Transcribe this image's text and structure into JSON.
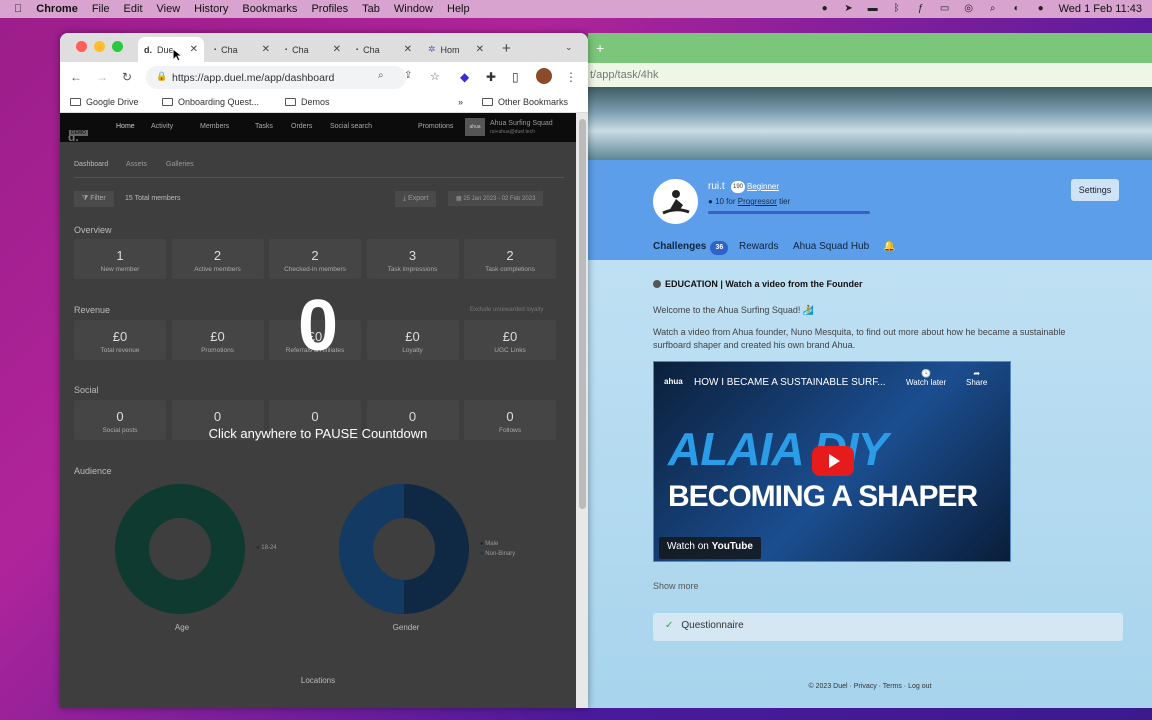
{
  "menubar": {
    "app": "Chrome",
    "items": [
      "File",
      "Edit",
      "View",
      "History",
      "Bookmarks",
      "Profiles",
      "Tab",
      "Window",
      "Help"
    ],
    "clock": "Wed 1 Feb  11:43"
  },
  "left_browser": {
    "tabs": [
      {
        "icon_text": "d.",
        "label": "Due"
      },
      {
        "label": "Cha"
      },
      {
        "label": "Cha"
      },
      {
        "label": "Cha"
      },
      {
        "label": "Hom"
      }
    ],
    "url": "https://app.duel.me/app/dashboard",
    "bookmarks": [
      "Google Drive",
      "Onboarding Quest...",
      "Demos"
    ],
    "other_bookmarks": "Other Bookmarks",
    "chevron": "»"
  },
  "dashboard": {
    "logo": "d.",
    "logo_tag": "DEMO",
    "nav": [
      "Home",
      "Activity",
      "Members",
      "Tasks",
      "Orders",
      "Social search",
      "Promotions"
    ],
    "account_name": "Ahua Surfing Squad",
    "account_email": "rui+ahua@duel.tech",
    "account_logo": "ahua",
    "subtabs": [
      "Dashboard",
      "Assets",
      "Galleries"
    ],
    "filter": "Filter",
    "members_total": "15 Total members",
    "export": "Export",
    "date_range": "25 Jan 2023 - 02 Feb 2023",
    "overview_title": "Overview",
    "overview": [
      {
        "value": "1",
        "label": "New member"
      },
      {
        "value": "2",
        "label": "Active members"
      },
      {
        "value": "2",
        "label": "Checked-in members"
      },
      {
        "value": "3",
        "label": "Task impressions"
      },
      {
        "value": "2",
        "label": "Task completions"
      }
    ],
    "revenue_title": "Revenue",
    "exclude_label": "Exclude unrewarded loyalty",
    "revenue": [
      {
        "value": "£0",
        "label": "Total revenue"
      },
      {
        "value": "£0",
        "label": "Promotions"
      },
      {
        "value": "£0",
        "label": "Referrals & Affiliates"
      },
      {
        "value": "£0",
        "label": "Loyalty"
      },
      {
        "value": "£0",
        "label": "UGC Links"
      }
    ],
    "social_title": "Social",
    "social": [
      {
        "value": "0",
        "label": "Social posts"
      },
      {
        "value": "0",
        "label": ""
      },
      {
        "value": "0",
        "label": ""
      },
      {
        "value": "0",
        "label": ""
      },
      {
        "value": "0",
        "label": "Follows"
      }
    ],
    "audience_title": "Audience",
    "age_legend": "18-24",
    "gender_legend": [
      "Male",
      "Non-Binary"
    ],
    "age_caption": "Age",
    "gender_caption": "Gender",
    "locations": "Locations"
  },
  "countdown": {
    "number": "0",
    "message": "Click anywhere to PAUSE Countdown"
  },
  "right_page": {
    "url_fragment": "t/app/task/4hk",
    "username": "rui.t",
    "level": "190",
    "rank": "Beginner",
    "tier_prefix": "10 for",
    "tier_link": "Progressor",
    "tier_suffix": "tier",
    "settings": "Settings",
    "tabs": {
      "challenges": "Challenges",
      "challenges_count": "36",
      "rewards": "Rewards",
      "hub": "Ahua Squad Hub"
    },
    "task_title": "EDUCATION | Watch a video from the Founder",
    "welcome": "Welcome to the Ahua Surfing Squad! 🏄",
    "description": "Watch a video from Ahua founder, Nuno Mesquita, to find out more about how he became a sustainable surfboard shaper and created his own brand Ahua.",
    "video": {
      "channel": "ahua",
      "title": "HOW I BECAME A SUSTAINABLE SURF...",
      "big1": "ALAIA DIY",
      "big2": "BECOMING A SHAPER",
      "watch_later": "Watch later",
      "share": "Share",
      "watch_on": "Watch on",
      "yt": "YouTube"
    },
    "show_more": "Show more",
    "questionnaire": "Questionnaire",
    "footer": "© 2023 Duel  ·  Privacy  ·  Terms  ·  Log out"
  },
  "colors": {
    "accent": "#2e63c9",
    "profile_bg": "#5c9eea",
    "check": "#2ea84a"
  }
}
